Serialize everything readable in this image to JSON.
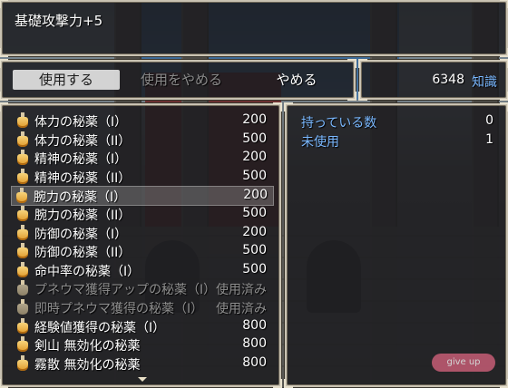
{
  "help": {
    "text": "基礎攻撃力+5"
  },
  "commands": [
    {
      "label": "使用する",
      "state": "selected"
    },
    {
      "label": "使用をやめる",
      "state": "disabled"
    },
    {
      "label": "やめる",
      "state": "normal"
    }
  ],
  "currency": {
    "value": "6348",
    "unit": "知識"
  },
  "items": [
    {
      "name": "体力の秘薬（I）",
      "value": "200",
      "disabled": false,
      "selected": false
    },
    {
      "name": "体力の秘薬（II）",
      "value": "500",
      "disabled": false,
      "selected": false
    },
    {
      "name": "精神の秘薬（I）",
      "value": "200",
      "disabled": false,
      "selected": false
    },
    {
      "name": "精神の秘薬（II）",
      "value": "500",
      "disabled": false,
      "selected": false
    },
    {
      "name": "腕力の秘薬（I）",
      "value": "200",
      "disabled": false,
      "selected": true
    },
    {
      "name": "腕力の秘薬（II）",
      "value": "500",
      "disabled": false,
      "selected": false
    },
    {
      "name": "防御の秘薬（I）",
      "value": "200",
      "disabled": false,
      "selected": false
    },
    {
      "name": "防御の秘薬（II）",
      "value": "500",
      "disabled": false,
      "selected": false
    },
    {
      "name": "命中率の秘薬（I）",
      "value": "500",
      "disabled": false,
      "selected": false
    },
    {
      "name": "プネウマ獲得アップの秘薬（I）",
      "value": "使用済み",
      "disabled": true,
      "selected": false
    },
    {
      "name": "即時プネウマ獲得の秘薬（I）",
      "value": "使用済み",
      "disabled": true,
      "selected": false
    },
    {
      "name": "経験値獲得の秘薬（I）",
      "value": "800",
      "disabled": false,
      "selected": false
    },
    {
      "name": "剣山 無効化の秘薬",
      "value": "800",
      "disabled": false,
      "selected": false
    },
    {
      "name": "霧散 無効化の秘薬",
      "value": "800",
      "disabled": false,
      "selected": false
    }
  ],
  "info": {
    "owned_label": "持っている数",
    "owned_value": "0",
    "unused_label": "未使用",
    "unused_value": "1"
  },
  "icons": {
    "item": "potion-icon",
    "scroll": "scroll-down-arrow-icon"
  },
  "colors": {
    "accent": "#7ab8ff",
    "disabled": "#8e8e8e",
    "window_border": "#c9c2b2"
  }
}
